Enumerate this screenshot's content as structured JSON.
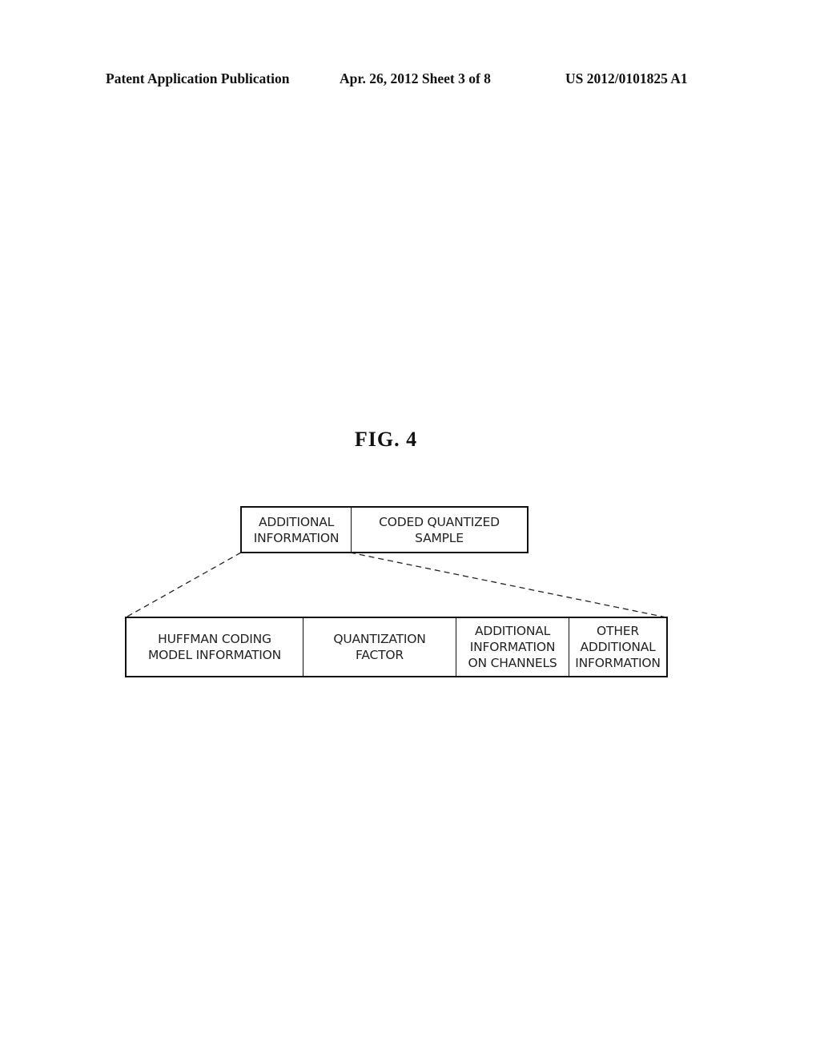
{
  "header": {
    "publication_type": "Patent Application Publication",
    "date_sheet": "Apr. 26, 2012  Sheet 3 of 8",
    "publication_number": "US 2012/0101825 A1"
  },
  "figure": {
    "title": "FIG.  4",
    "frame": {
      "fields": [
        {
          "label": "ADDITIONAL\nINFORMATION"
        },
        {
          "label": "CODED QUANTIZED\nSAMPLE"
        }
      ]
    },
    "expanded_additional_information": {
      "fields": [
        {
          "label": "HUFFMAN CODING\nMODEL INFORMATION"
        },
        {
          "label": "QUANTIZATION\nFACTOR"
        },
        {
          "label": "ADDITIONAL\nINFORMATION\nON CHANNELS"
        },
        {
          "label": "OTHER\nADDITIONAL\nINFORMATION"
        }
      ]
    }
  }
}
